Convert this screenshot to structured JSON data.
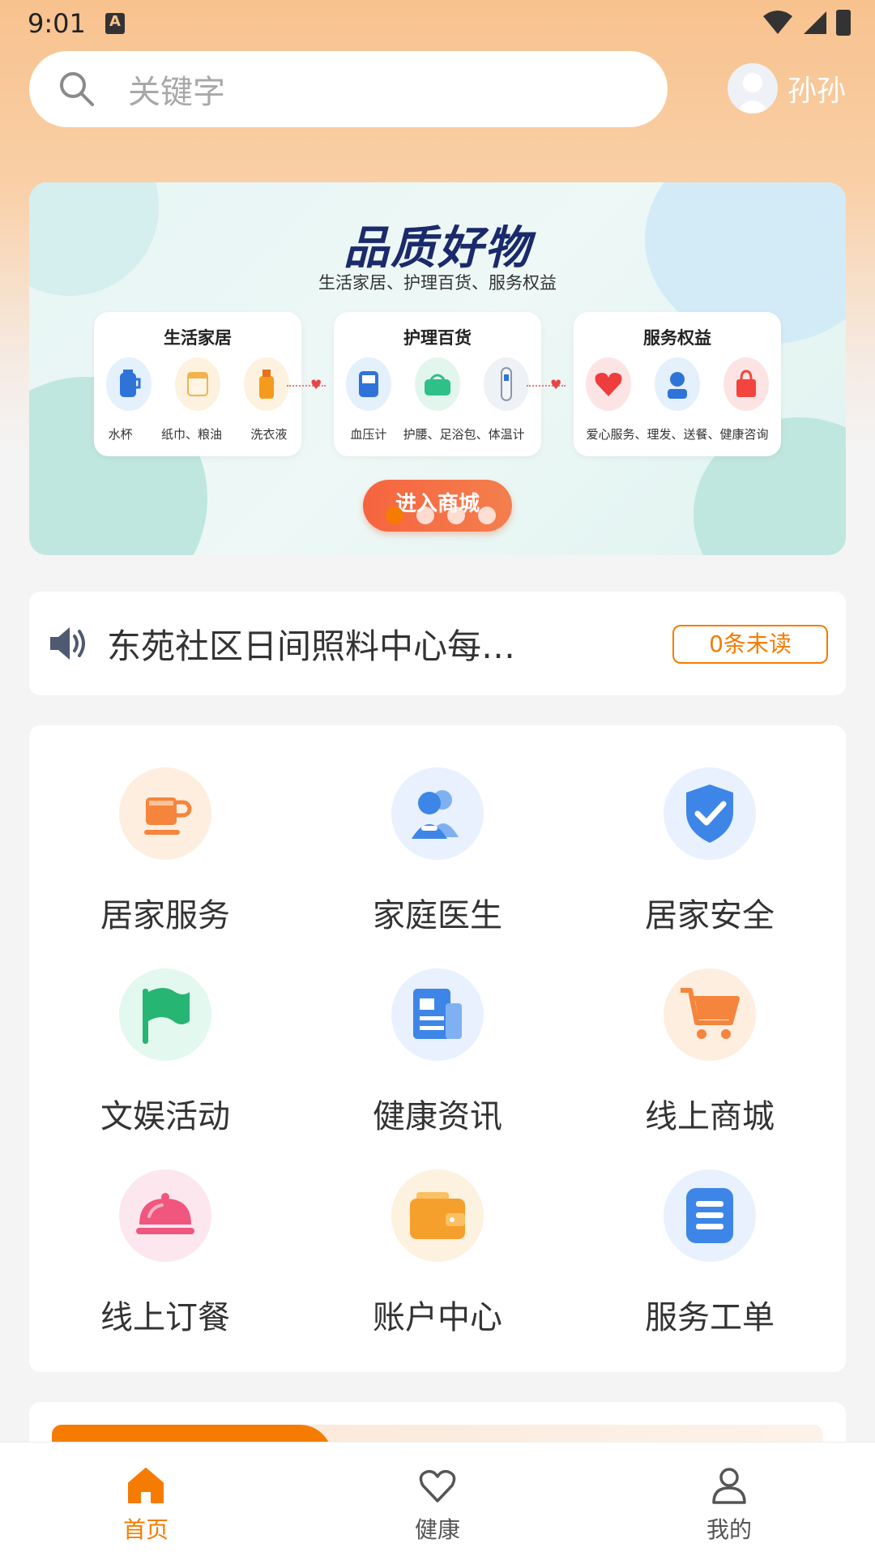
{
  "status_bar": {
    "time": "9:01",
    "notification_glyph": "A"
  },
  "header": {
    "search_placeholder": "关键字",
    "user_name": "孙孙"
  },
  "banner": {
    "title": "品质好物",
    "subtitle": "生活家居、护理百货、服务权益",
    "categories": [
      {
        "title": "生活家居",
        "captions": [
          "水杯",
          "纸巾、粮油",
          "洗衣液"
        ]
      },
      {
        "title": "护理百货",
        "captions": [
          "血压计",
          "护腰、足浴包、体温计"
        ]
      },
      {
        "title": "服务权益",
        "captions": [
          "爱心服务、理发、送餐、健康咨询"
        ]
      }
    ],
    "button_label": "进入商城",
    "carousel_active_index": 0
  },
  "notice": {
    "text": "东苑社区日间照料中心每…",
    "unread_label": "0条未读"
  },
  "services": [
    {
      "label": "居家服务",
      "icon": "coffee-cup-icon",
      "bg": "#fdeee0",
      "color": "#f5843c"
    },
    {
      "label": "家庭医生",
      "icon": "doctor-people-icon",
      "bg": "#e8f1fd",
      "color": "#3d86e8"
    },
    {
      "label": "居家安全",
      "icon": "shield-check-icon",
      "bg": "#e8f1fd",
      "color": "#3d86e8"
    },
    {
      "label": "文娱活动",
      "icon": "flag-icon",
      "bg": "#e3f8ee",
      "color": "#27b574"
    },
    {
      "label": "健康资讯",
      "icon": "news-document-icon",
      "bg": "#e8f1fd",
      "color": "#3d86e8"
    },
    {
      "label": "线上商城",
      "icon": "shopping-cart-icon",
      "bg": "#fdeee0",
      "color": "#f5843c"
    },
    {
      "label": "线上订餐",
      "icon": "food-cloche-icon",
      "bg": "#fde7ee",
      "color": "#f0567e"
    },
    {
      "label": "账户中心",
      "icon": "wallet-icon",
      "bg": "#fdf1df",
      "color": "#f5a02c"
    },
    {
      "label": "服务工单",
      "icon": "order-list-icon",
      "bg": "#e8f1fd",
      "color": "#3d86e8"
    }
  ],
  "tab_bar": {
    "tabs": [
      {
        "label": "首页",
        "icon": "home-icon",
        "active": true
      },
      {
        "label": "健康",
        "icon": "heart-icon",
        "active": false
      },
      {
        "label": "我的",
        "icon": "person-icon",
        "active": false
      }
    ],
    "accent": "#f57c00"
  }
}
